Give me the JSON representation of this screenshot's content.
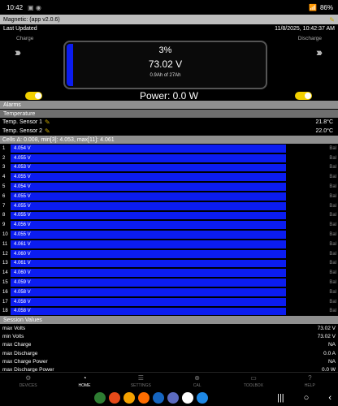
{
  "status": {
    "time": "10:42",
    "battery": "86%"
  },
  "app_title": "Magnetic: (app v2.0.6)",
  "last_updated": {
    "label": "Last Updated",
    "value": "11/8/2025, 10:42:37 AM"
  },
  "battery": {
    "charge_label": "Charge",
    "discharge_label": "Discharge",
    "percent": "3%",
    "percent_value": 0.03,
    "voltage": "73.02 V",
    "ah": "0.9Ah of 27Ah",
    "power": "Power: 0.0 W"
  },
  "colors": {
    "fill": "#0b1cf0",
    "toggle": "#f2d000",
    "section": "#8f8f8f"
  },
  "alarms_label": "Alarms",
  "temperature": {
    "label": "Temperature",
    "sensors": [
      {
        "name": "Temp. Sensor 1",
        "value": "21.8°C"
      },
      {
        "name": "Temp. Sensor 2",
        "value": "22.0°C"
      }
    ]
  },
  "cells": {
    "header": "Cells Δ: 0.008, min[3]: 4.053, max[11]: 4.061",
    "balance_label": "Bal",
    "items": [
      {
        "index": "1",
        "value": "4.054 V"
      },
      {
        "index": "2",
        "value": "4.055 V"
      },
      {
        "index": "3",
        "value": "4.053 V"
      },
      {
        "index": "4",
        "value": "4.055 V"
      },
      {
        "index": "5",
        "value": "4.054 V"
      },
      {
        "index": "6",
        "value": "4.055 V"
      },
      {
        "index": "7",
        "value": "4.055 V"
      },
      {
        "index": "8",
        "value": "4.055 V"
      },
      {
        "index": "9",
        "value": "4.056 V"
      },
      {
        "index": "10",
        "value": "4.055 V"
      },
      {
        "index": "11",
        "value": "4.061 V"
      },
      {
        "index": "12",
        "value": "4.060 V"
      },
      {
        "index": "13",
        "value": "4.061 V"
      },
      {
        "index": "14",
        "value": "4.060 V"
      },
      {
        "index": "15",
        "value": "4.059 V"
      },
      {
        "index": "16",
        "value": "4.058 V"
      },
      {
        "index": "17",
        "value": "4.058 V"
      },
      {
        "index": "18",
        "value": "4.058 V"
      }
    ]
  },
  "session": {
    "label": "Session Values",
    "rows": [
      {
        "name": "max Volts",
        "value": "73.02 V"
      },
      {
        "name": "min Volts",
        "value": "73.02 V"
      },
      {
        "name": "max Charge",
        "value": "NA"
      },
      {
        "name": "max Discharge",
        "value": "0.0 A"
      },
      {
        "name": "max Charge Power",
        "value": "NA"
      },
      {
        "name": "max Discharge Power",
        "value": "0.0 W"
      }
    ]
  },
  "nav": [
    {
      "label": "DEVICES",
      "icon": "devices-icon",
      "glyph": "⚙"
    },
    {
      "label": "HOME",
      "icon": "home-icon",
      "glyph": "◔"
    },
    {
      "label": "SETTINGS",
      "icon": "settings-icon",
      "glyph": "☰"
    },
    {
      "label": "CAL",
      "icon": "cal-icon",
      "glyph": "⊕"
    },
    {
      "label": "TOOLBOX",
      "icon": "toolbox-icon",
      "glyph": "▭"
    },
    {
      "label": "HELP",
      "icon": "help-icon",
      "glyph": "?"
    }
  ],
  "dock_apps": [
    "#2e7d32",
    "#e64a19",
    "#f4a100",
    "#ff6d00",
    "#1565c0",
    "#5c6bc0",
    "#ffffff",
    "#1e88e5"
  ]
}
